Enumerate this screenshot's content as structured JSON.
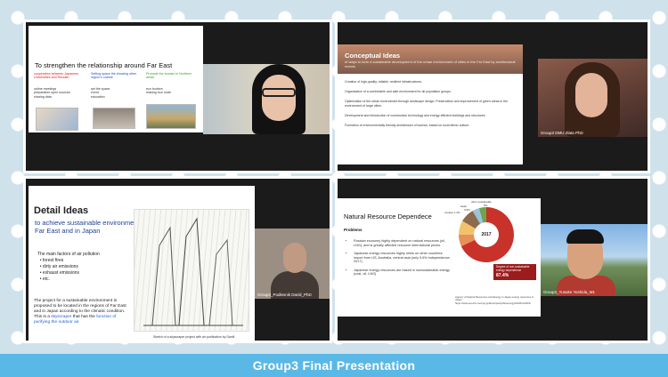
{
  "footer": {
    "title": "Group3 Final Presentation"
  },
  "panel1": {
    "slide_title": "To strengthen the relationship around Far East",
    "col1_heading": "cooperation between Japanese Universities and Russian",
    "col1_items": "online meetings\npreparation open sources\nsharing data",
    "col2_heading": "Setting space the showing other region`s culture",
    "col2_items": "set the space\nevent\neducation",
    "col3_heading": "Promote the tourism in Northern areas",
    "col3_items": "eco tourism\nmaking tour route"
  },
  "panel2": {
    "slide_title": "Conceptual Ideas",
    "slide_subtitle": "of ways to form a sustainable development of the urban environment of cities in the Far East by architectural means",
    "items": [
      "Creation of high-quality, reliable, resilient infrastructures.",
      "Organization of a comfortable and safe environment for all population groups.",
      "Optimization of the urban environment through landscape design. Preservation and improvement of green areas in the environment of large cities.",
      "Development and introduction of construction technology and energy efficient buildings and structures.",
      "Formation of environmentally friendly architecture of tourism, based on local ethnic culture."
    ],
    "cam_label": "Group3 DMU Zlata PhD"
  },
  "panel3": {
    "slide_title": "Detail Ideas",
    "slide_subtitle": "to achieve sustainable environment in the Far East and in Japan",
    "factors_heading": "The main factors of air pollution",
    "factors": [
      "forest fires",
      "dirty air emissions",
      "exhaust emissions",
      "etc."
    ],
    "paragraph": "The project for a sustainable environment is proposed to be located in the regions of Far East and in Japan according to the climatic condition. This is a",
    "highlight1": "skyscraper",
    "paragraph2": "that has the",
    "highlight2": "function of purifying the outdoor air.",
    "caption": "Sketch of a skyscraper project with air purification by Danill",
    "cam_label": "Group3_Podlesnik Daniil_PhD"
  },
  "panel4": {
    "slide_title": "Natural Resource Dependece",
    "problems_heading": "Problems",
    "items": [
      "Russian economy highly dependent on natural resources (oil, LNG), and is greatly affected resource international prices.",
      "Japanese energy resources highly relies on other countries: import from US, Australia, central asia (only 9.6% independence; 2017)",
      "Japanese energy resources are based in nonsustainable energy (coal, oil, LNG)"
    ],
    "source": "Agency of Natural Resources and Energy in Japan energy resources in Japan https://www.enecho.meti.go.jp/about/pamphlet/energy2019/html/001/",
    "chart_year": "2017",
    "callout_text": "Degree of non-sustainable energy dependence",
    "callout_value": "87.4%",
    "label_other": "other sustainable",
    "label_water": "water",
    "label_nuclear": "nuclear 1.4%",
    "label_pct1": "6%",
    "label_pct2": "3.5%",
    "cam_label": "Group3_Yusuke Yoshida_M1"
  },
  "colors": {
    "footer": "#5ab8e6",
    "panel_border": "#ffffff"
  }
}
